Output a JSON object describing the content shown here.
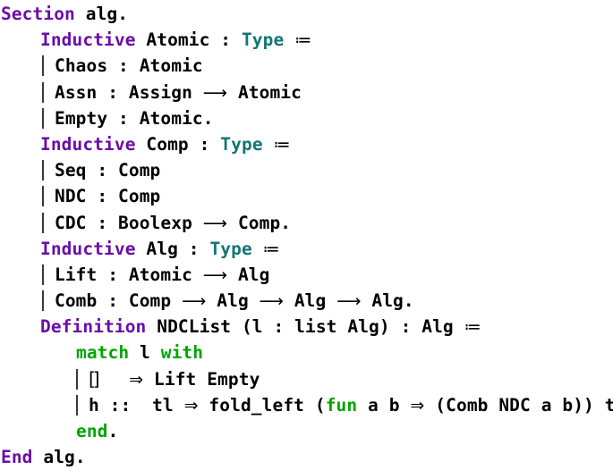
{
  "document": {
    "language": "Coq",
    "background_color": "#ffffff",
    "colors": {
      "keyword": "#6a0da8",
      "type": "#137575",
      "green_keyword": "#00a600",
      "plain_text": "#000000",
      "bar": "#3a3a3a"
    }
  },
  "lines": [
    {
      "id": "line-section",
      "indent": "ind0",
      "tokens": [
        {
          "cls": "kw",
          "text": "Section"
        },
        {
          "cls": "plain",
          "text": " alg."
        }
      ]
    },
    {
      "id": "line-inductive-atomic",
      "indent": "ind1",
      "tokens": [
        {
          "cls": "kw",
          "text": "Inductive"
        },
        {
          "cls": "plain",
          "text": " Atomic : "
        },
        {
          "cls": "type",
          "text": "Type"
        },
        {
          "cls": "plain",
          "text": " "
        },
        {
          "cls": "coloneq",
          "text": "≔"
        }
      ]
    },
    {
      "id": "line-chaos",
      "indent": "ind2",
      "bar": true,
      "tokens": [
        {
          "cls": "plain",
          "text": "Chaos : Atomic"
        }
      ]
    },
    {
      "id": "line-assn",
      "indent": "ind2",
      "bar": true,
      "tokens": [
        {
          "cls": "plain",
          "text": "Assn : Assign "
        },
        {
          "cls": "arrow",
          "text": "⟶"
        },
        {
          "cls": "plain",
          "text": " Atomic"
        }
      ]
    },
    {
      "id": "line-empty",
      "indent": "ind2",
      "bar": true,
      "tokens": [
        {
          "cls": "plain",
          "text": "Empty : Atomic."
        }
      ]
    },
    {
      "id": "line-inductive-comp",
      "indent": "ind1",
      "tokens": [
        {
          "cls": "kw",
          "text": "Inductive"
        },
        {
          "cls": "plain",
          "text": " Comp : "
        },
        {
          "cls": "type",
          "text": "Type"
        },
        {
          "cls": "plain",
          "text": " "
        },
        {
          "cls": "coloneq",
          "text": "≔"
        }
      ]
    },
    {
      "id": "line-seq",
      "indent": "ind2",
      "bar": true,
      "tokens": [
        {
          "cls": "plain",
          "text": "Seq : Comp"
        }
      ]
    },
    {
      "id": "line-ndc",
      "indent": "ind2",
      "bar": true,
      "tokens": [
        {
          "cls": "plain",
          "text": "NDC : Comp"
        }
      ]
    },
    {
      "id": "line-cdc",
      "indent": "ind2",
      "bar": true,
      "tokens": [
        {
          "cls": "plain",
          "text": "CDC : Boolexp "
        },
        {
          "cls": "arrow",
          "text": "⟶"
        },
        {
          "cls": "plain",
          "text": " Comp."
        }
      ]
    },
    {
      "id": "line-inductive-alg",
      "indent": "ind1",
      "tokens": [
        {
          "cls": "kw",
          "text": "Inductive"
        },
        {
          "cls": "plain",
          "text": " Alg : "
        },
        {
          "cls": "type",
          "text": "Type"
        },
        {
          "cls": "plain",
          "text": " "
        },
        {
          "cls": "coloneq",
          "text": "≔"
        }
      ]
    },
    {
      "id": "line-lift",
      "indent": "ind2",
      "bar": true,
      "tokens": [
        {
          "cls": "plain",
          "text": "Lift : Atomic "
        },
        {
          "cls": "arrow",
          "text": "⟶"
        },
        {
          "cls": "plain",
          "text": " Alg"
        }
      ]
    },
    {
      "id": "line-comb",
      "indent": "ind2",
      "bar": true,
      "tokens": [
        {
          "cls": "plain",
          "text": "Comb : Comp "
        },
        {
          "cls": "arrow",
          "text": "⟶"
        },
        {
          "cls": "plain",
          "text": " Alg "
        },
        {
          "cls": "arrow",
          "text": "⟶"
        },
        {
          "cls": "plain",
          "text": " Alg "
        },
        {
          "cls": "arrow",
          "text": "⟶"
        },
        {
          "cls": "plain",
          "text": " Alg."
        }
      ]
    },
    {
      "id": "line-definition-ndclist",
      "indent": "ind1",
      "tokens": [
        {
          "cls": "kw",
          "text": "Definition"
        },
        {
          "cls": "plain",
          "text": " NDCList (l : list Alg) : Alg "
        },
        {
          "cls": "coloneq",
          "text": "≔"
        }
      ]
    },
    {
      "id": "line-match",
      "indent": "ind3",
      "tokens": [
        {
          "cls": "green",
          "text": "match"
        },
        {
          "cls": "plain",
          "text": " l "
        },
        {
          "cls": "green",
          "text": "with"
        }
      ]
    },
    {
      "id": "line-case-nil",
      "indent": "ind3",
      "bar": true,
      "tokens": [
        {
          "cls": "nilglyph",
          "text": "[]"
        },
        {
          "cls": "plain",
          "text": "   "
        },
        {
          "cls": "darrow",
          "text": "⇒"
        },
        {
          "cls": "plain",
          "text": " Lift Empty"
        }
      ]
    },
    {
      "id": "line-case-cons",
      "indent": "ind3",
      "bar": true,
      "tokens": [
        {
          "cls": "plain",
          "text": "h ::  tl "
        },
        {
          "cls": "darrow",
          "text": "⇒"
        },
        {
          "cls": "plain",
          "text": " fold_left ("
        },
        {
          "cls": "green",
          "text": "fun"
        },
        {
          "cls": "plain",
          "text": " a b "
        },
        {
          "cls": "darrow",
          "text": "⇒"
        },
        {
          "cls": "plain",
          "text": " (Comb NDC a b)) tl h"
        }
      ]
    },
    {
      "id": "line-end-match",
      "indent": "ind3",
      "tokens": [
        {
          "cls": "green",
          "text": "end"
        },
        {
          "cls": "plain",
          "text": "."
        }
      ]
    },
    {
      "id": "line-end-section",
      "indent": "ind0",
      "tokens": [
        {
          "cls": "kw",
          "text": "End"
        },
        {
          "cls": "plain",
          "text": " alg."
        }
      ]
    }
  ]
}
